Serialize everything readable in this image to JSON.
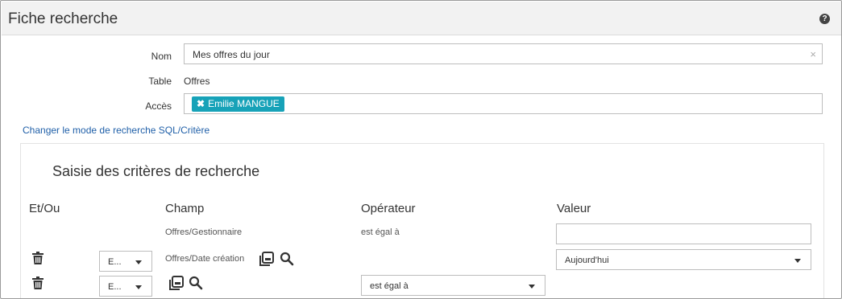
{
  "header": {
    "title": "Fiche recherche",
    "help_icon": "question-circle-icon"
  },
  "form": {
    "nom_label": "Nom",
    "nom_value": "Mes offres du jour",
    "clear_symbol": "×",
    "table_label": "Table",
    "table_value": "Offres",
    "acces_label": "Accès",
    "acces_chip": {
      "x": "✖",
      "label": "Emilie MANGUE"
    }
  },
  "switch_link": "Changer le mode de recherche SQL/Critère",
  "criteria": {
    "title": "Saisie des critères de recherche",
    "columns": [
      "Et/Ou",
      "Champ",
      "Opérateur",
      "Valeur"
    ],
    "rows": [
      {
        "champ": "Offres/Gestionnaire",
        "operateur": "est égal à",
        "valeur": ""
      },
      {
        "andor": "E...",
        "champ": "Offres/Date création",
        "valeur": "Aujourd'hui"
      },
      {
        "andor": "E...",
        "operateur": "est égal à"
      }
    ]
  },
  "colors": {
    "accent_chip": "#17a2b8",
    "link": "#1f5fa8"
  }
}
